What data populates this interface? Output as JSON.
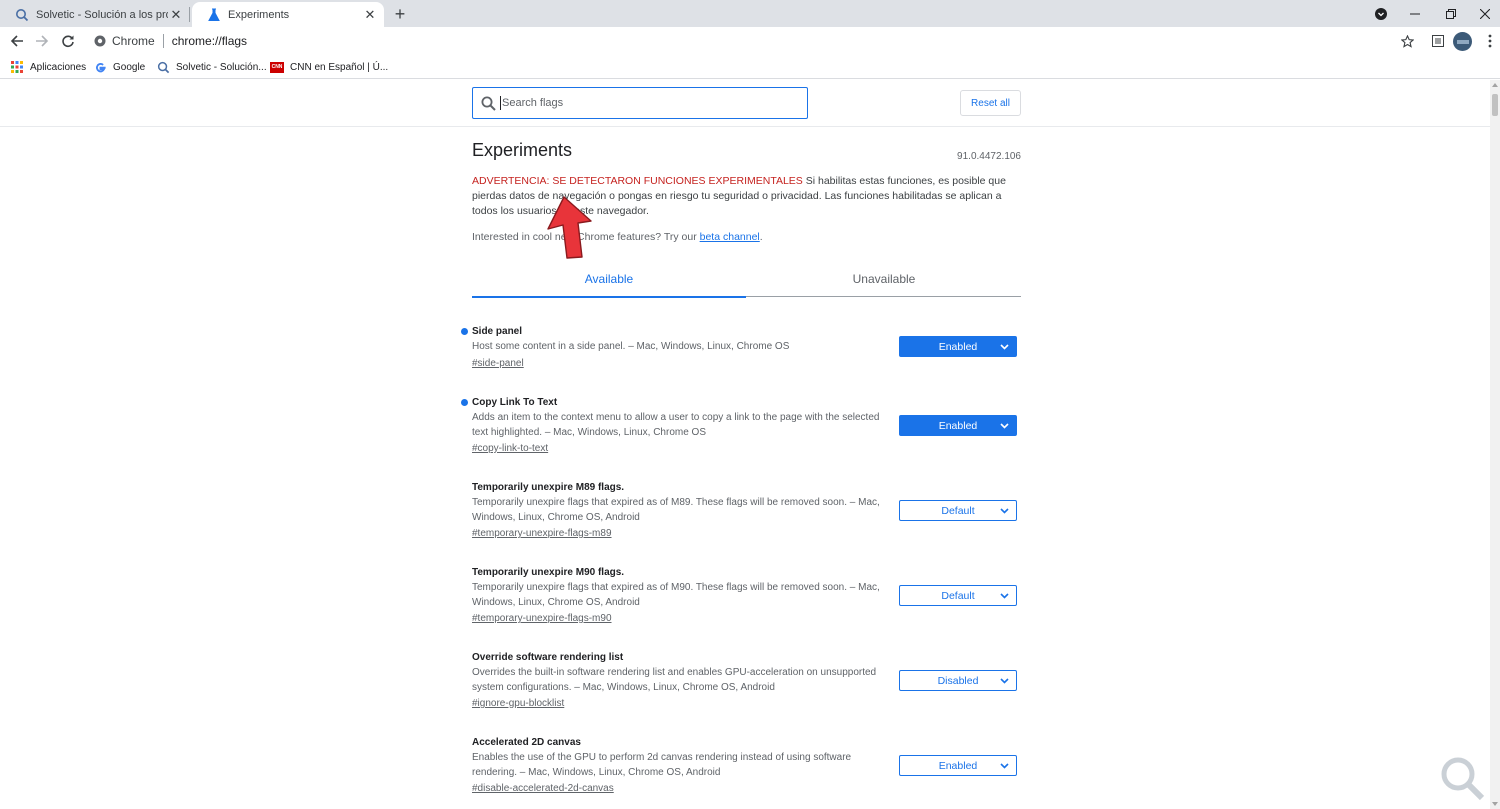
{
  "browser": {
    "tabs": [
      {
        "label": "Solvetic - Solución a los problem",
        "active": false
      },
      {
        "label": "Experiments",
        "active": true
      }
    ],
    "omnibox": {
      "site": "Chrome",
      "url": "chrome://flags"
    },
    "bookmarks": [
      {
        "label": "Aplicaciones"
      },
      {
        "label": "Google"
      },
      {
        "label": "Solvetic - Solución..."
      },
      {
        "label": "CNN en Español | Ú..."
      }
    ],
    "cnn_logo_text": "CNN"
  },
  "header": {
    "search_placeholder": "Search flags",
    "reset_label": "Reset all"
  },
  "page": {
    "title": "Experiments",
    "version": "91.0.4472.106",
    "warning_prefix": "ADVERTENCIA: SE DETECTARON FUNCIONES EXPERIMENTALES",
    "warning_body": " Si habilitas estas funciones, es posible que pierdas datos de navegación o pongas en riesgo tu seguridad o privacidad. Las funciones habilitadas se aplican a todos los usuarios de este navegador.",
    "beta_text": "Interested in cool new Chrome features? Try our ",
    "beta_link": "beta channel",
    "beta_suffix": "."
  },
  "tabs": {
    "available": "Available",
    "unavailable": "Unavailable"
  },
  "flags": [
    {
      "name": "Side panel",
      "desc": "Host some content in a side panel. – Mac, Windows, Linux, Chrome OS",
      "id": "#side-panel",
      "value": "Enabled",
      "modified": true
    },
    {
      "name": "Copy Link To Text",
      "desc": "Adds an item to the context menu to allow a user to copy a link to the page with the selected text highlighted. – Mac, Windows, Linux, Chrome OS",
      "id": "#copy-link-to-text",
      "value": "Enabled",
      "modified": true
    },
    {
      "name": "Temporarily unexpire M89 flags.",
      "desc": "Temporarily unexpire flags that expired as of M89. These flags will be removed soon. – Mac, Windows, Linux, Chrome OS, Android",
      "id": "#temporary-unexpire-flags-m89",
      "value": "Default",
      "modified": false
    },
    {
      "name": "Temporarily unexpire M90 flags.",
      "desc": "Temporarily unexpire flags that expired as of M90. These flags will be removed soon. – Mac, Windows, Linux, Chrome OS, Android",
      "id": "#temporary-unexpire-flags-m90",
      "value": "Default",
      "modified": false
    },
    {
      "name": "Override software rendering list",
      "desc": "Overrides the built-in software rendering list and enables GPU-acceleration on unsupported system configurations. – Mac, Windows, Linux, Chrome OS, Android",
      "id": "#ignore-gpu-blocklist",
      "value": "Disabled",
      "modified": false
    },
    {
      "name": "Accelerated 2D canvas",
      "desc": "Enables the use of the GPU to perform 2d canvas rendering instead of using software rendering. – Mac, Windows, Linux, Chrome OS, Android",
      "id": "#disable-accelerated-2d-canvas",
      "value": "Enabled",
      "modified": false
    }
  ],
  "colors": {
    "accent": "#1a73e8",
    "warning": "#c5221f",
    "arrow": "#e8343a"
  }
}
